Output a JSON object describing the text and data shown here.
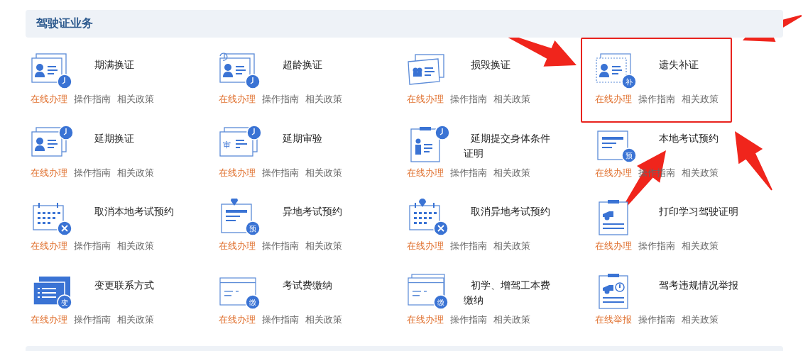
{
  "section": {
    "title": "驾驶证业务"
  },
  "items": [
    {
      "title": "期满换证",
      "kind": "card",
      "overlay": {
        "kind": "clock"
      },
      "highlighted": false,
      "links": [
        {
          "label": "在线办理",
          "kind": "primary"
        },
        {
          "label": "操作指南",
          "kind": "plain"
        },
        {
          "label": "相关政策",
          "kind": "plain"
        }
      ]
    },
    {
      "title": "超龄换证",
      "kind": "card-renew",
      "overlay": {
        "kind": "clock"
      },
      "highlighted": false,
      "links": [
        {
          "label": "在线办理",
          "kind": "primary"
        },
        {
          "label": "操作指南",
          "kind": "plain"
        },
        {
          "label": "相关政策",
          "kind": "plain"
        }
      ]
    },
    {
      "title": "损毁换证",
      "kind": "card-tilted",
      "highlighted": false,
      "links": [
        {
          "label": "在线办理",
          "kind": "primary"
        },
        {
          "label": "操作指南",
          "kind": "plain"
        },
        {
          "label": "相关政策",
          "kind": "plain"
        }
      ]
    },
    {
      "title": "遗失补证",
      "kind": "card-dashed",
      "overlay": {
        "kind": "label",
        "text": "补"
      },
      "highlighted": true,
      "links": [
        {
          "label": "在线办理",
          "kind": "primary"
        },
        {
          "label": "操作指南",
          "kind": "plain"
        },
        {
          "label": "相关政策",
          "kind": "plain"
        }
      ]
    },
    {
      "title": "延期换证",
      "kind": "card",
      "overlay": {
        "kind": "clock-top"
      },
      "highlighted": false,
      "links": [
        {
          "label": "在线办理",
          "kind": "primary"
        },
        {
          "label": "操作指南",
          "kind": "plain"
        },
        {
          "label": "相关政策",
          "kind": "plain"
        }
      ]
    },
    {
      "title": "延期审验",
      "kind": "card-review",
      "review": "审",
      "overlay": {
        "kind": "clock-top"
      },
      "highlighted": false,
      "links": [
        {
          "label": "在线办理",
          "kind": "primary"
        },
        {
          "label": "操作指南",
          "kind": "plain"
        },
        {
          "label": "相关政策",
          "kind": "plain"
        }
      ]
    },
    {
      "title": "延期提交身体条件证明",
      "kind": "clipboard-person",
      "overlay": {
        "kind": "clock-top"
      },
      "highlighted": false,
      "links": [
        {
          "label": "在线办理",
          "kind": "primary"
        },
        {
          "label": "操作指南",
          "kind": "plain"
        },
        {
          "label": "相关政策",
          "kind": "plain"
        }
      ]
    },
    {
      "title": "本地考试预约",
      "kind": "form",
      "overlay": {
        "kind": "label",
        "text": "预"
      },
      "highlighted": false,
      "links": [
        {
          "label": "在线办理",
          "kind": "primary"
        },
        {
          "label": "操作指南",
          "kind": "plain"
        },
        {
          "label": "相关政策",
          "kind": "plain"
        }
      ]
    },
    {
      "title": "取消本地考试预约",
      "kind": "calendar",
      "overlay": {
        "kind": "cancel"
      },
      "highlighted": false,
      "links": [
        {
          "label": "在线办理",
          "kind": "primary"
        },
        {
          "label": "操作指南",
          "kind": "plain"
        },
        {
          "label": "相关政策",
          "kind": "plain"
        }
      ]
    },
    {
      "title": "异地考试预约",
      "kind": "form-pin",
      "overlay": {
        "kind": "label",
        "text": "预"
      },
      "highlighted": false,
      "links": [
        {
          "label": "在线办理",
          "kind": "primary"
        },
        {
          "label": "操作指南",
          "kind": "plain"
        },
        {
          "label": "相关政策",
          "kind": "plain"
        }
      ]
    },
    {
      "title": "取消异地考试预约",
      "kind": "calendar-pin",
      "overlay": {
        "kind": "cancel"
      },
      "highlighted": false,
      "links": [
        {
          "label": "在线办理",
          "kind": "primary"
        },
        {
          "label": "操作指南",
          "kind": "plain"
        },
        {
          "label": "相关政策",
          "kind": "plain"
        }
      ]
    },
    {
      "title": "打印学习驾驶证明",
      "kind": "clipboard-car",
      "highlighted": false,
      "links": [
        {
          "label": "在线办理",
          "kind": "primary"
        },
        {
          "label": "操作指南",
          "kind": "plain"
        },
        {
          "label": "相关政策",
          "kind": "plain"
        }
      ]
    },
    {
      "title": "变更联系方式",
      "kind": "stack",
      "overlay": {
        "kind": "label",
        "text": "变"
      },
      "highlighted": false,
      "links": [
        {
          "label": "在线办理",
          "kind": "primary"
        },
        {
          "label": "操作指南",
          "kind": "plain"
        },
        {
          "label": "相关政策",
          "kind": "plain"
        }
      ]
    },
    {
      "title": "考试费缴纳",
      "kind": "bill",
      "overlay": {
        "kind": "label",
        "text": "缴"
      },
      "highlighted": false,
      "links": [
        {
          "label": "在线办理",
          "kind": "primary"
        },
        {
          "label": "操作指南",
          "kind": "plain"
        },
        {
          "label": "相关政策",
          "kind": "plain"
        }
      ]
    },
    {
      "title": "初学、增驾工本费缴纳",
      "kind": "bill-stack",
      "overlay": {
        "kind": "label",
        "text": "缴"
      },
      "highlighted": false,
      "links": [
        {
          "label": "在线办理",
          "kind": "primary"
        },
        {
          "label": "操作指南",
          "kind": "plain"
        },
        {
          "label": "相关政策",
          "kind": "plain"
        }
      ]
    },
    {
      "title": "驾考违规情况举报",
      "kind": "clipboard-car-alert",
      "highlighted": false,
      "links": [
        {
          "label": "在线举报",
          "kind": "primary"
        },
        {
          "label": "操作指南",
          "kind": "plain"
        },
        {
          "label": "相关政策",
          "kind": "plain"
        }
      ]
    }
  ]
}
